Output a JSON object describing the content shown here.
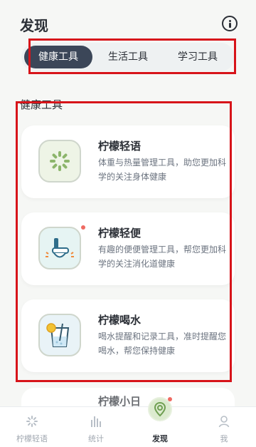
{
  "header": {
    "title": "发现"
  },
  "tabs": [
    {
      "label": "健康工具",
      "active": true
    },
    {
      "label": "生活工具",
      "active": false
    },
    {
      "label": "学习工具",
      "active": false
    }
  ],
  "section": {
    "title": "健康工具"
  },
  "cards": [
    {
      "title": "柠檬轻语",
      "description": "体重与热量管理工具，助您更加科学的关注身体健康",
      "icon": "lemon-slice-icon"
    },
    {
      "title": "柠檬轻便",
      "description": "有趣的便便管理工具，帮您更加科学的关注消化道健康",
      "icon": "toilet-icon",
      "has_notification_dot": true
    },
    {
      "title": "柠檬喝水",
      "description": "喝水提醒和记录工具，准时提醒您喝水，帮您保持健康",
      "icon": "water-glass-icon"
    }
  ],
  "partial_card": {
    "title": "柠檬小日"
  },
  "bottom_nav": [
    {
      "label": "柠檬轻语",
      "icon": "lemon-slice-icon",
      "active": false
    },
    {
      "label": "统计",
      "icon": "bar-chart-icon",
      "active": false
    },
    {
      "label": "发现",
      "icon": "location-pin-icon",
      "active": true
    },
    {
      "label": "我",
      "icon": "user-icon",
      "active": false
    }
  ],
  "colors": {
    "tab_active_bg": "#3b4658",
    "highlight_frame": "#d7141a",
    "notification_dot": "#ef6a62"
  }
}
